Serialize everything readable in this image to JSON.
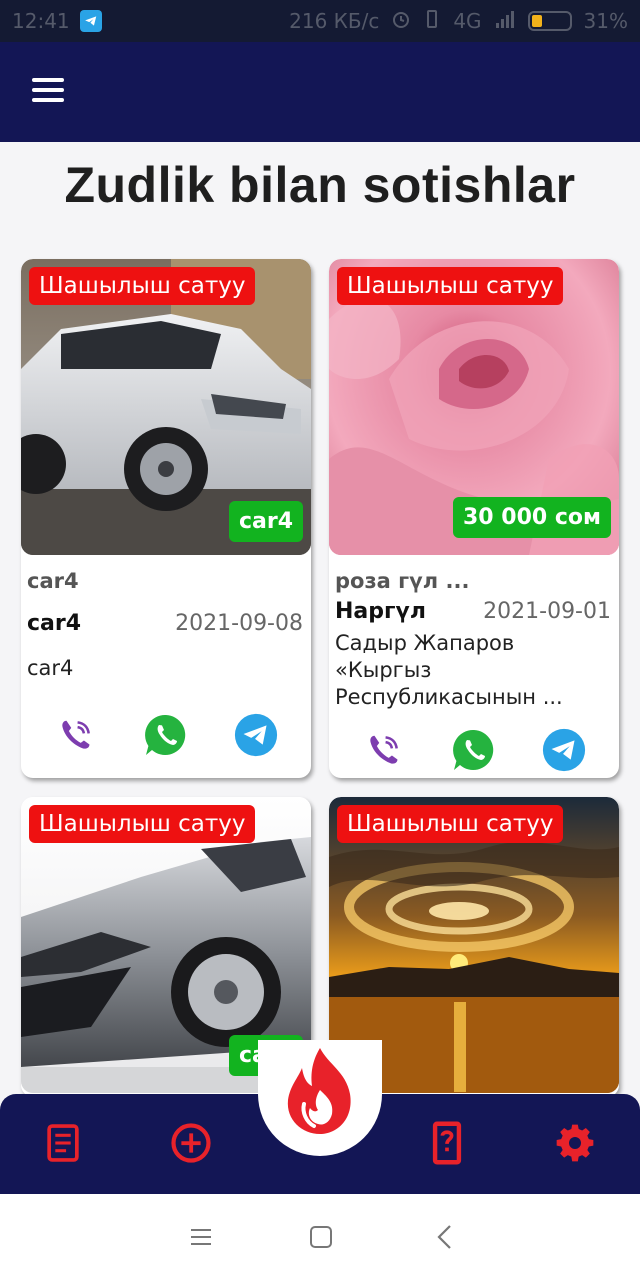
{
  "status_bar": {
    "time": "12:41",
    "speed": "216 КБ/с",
    "network": "4G",
    "battery": "31%"
  },
  "page": {
    "title": "Zudlik bilan sotishlar"
  },
  "cards": [
    {
      "urgent_label": "Шашылыш сатуу",
      "price": "car4",
      "subtitle": "car4",
      "owner": "car4",
      "date": "2021-09-08",
      "description": "car4",
      "image": "silver-suv-photo"
    },
    {
      "urgent_label": "Шашылыш сатуу",
      "price": "30 000 сом",
      "subtitle": "роза гүл ...",
      "owner": "Наргүл",
      "date": "2021-09-01",
      "description": "Садыр Жапаров «Кыргыз Республикасынын ...",
      "image": "pink-rose-photo"
    },
    {
      "urgent_label": "Шашылыш сатуу",
      "price": "car2",
      "image": "silver-sports-car-photo"
    },
    {
      "urgent_label": "Шашылыш сатуу",
      "image": "sunset-sea-photo"
    }
  ],
  "contacts": [
    "viber-icon",
    "whatsapp-icon",
    "telegram-icon"
  ],
  "bottom_nav": [
    "list-icon",
    "add-circle-icon",
    "fire-icon",
    "help-phone-icon",
    "settings-icon"
  ],
  "colors": {
    "app_bar": "#131655",
    "urgent_badge": "#ee1111",
    "price_badge": "#12b31f",
    "nav_icon": "#e8222a"
  }
}
